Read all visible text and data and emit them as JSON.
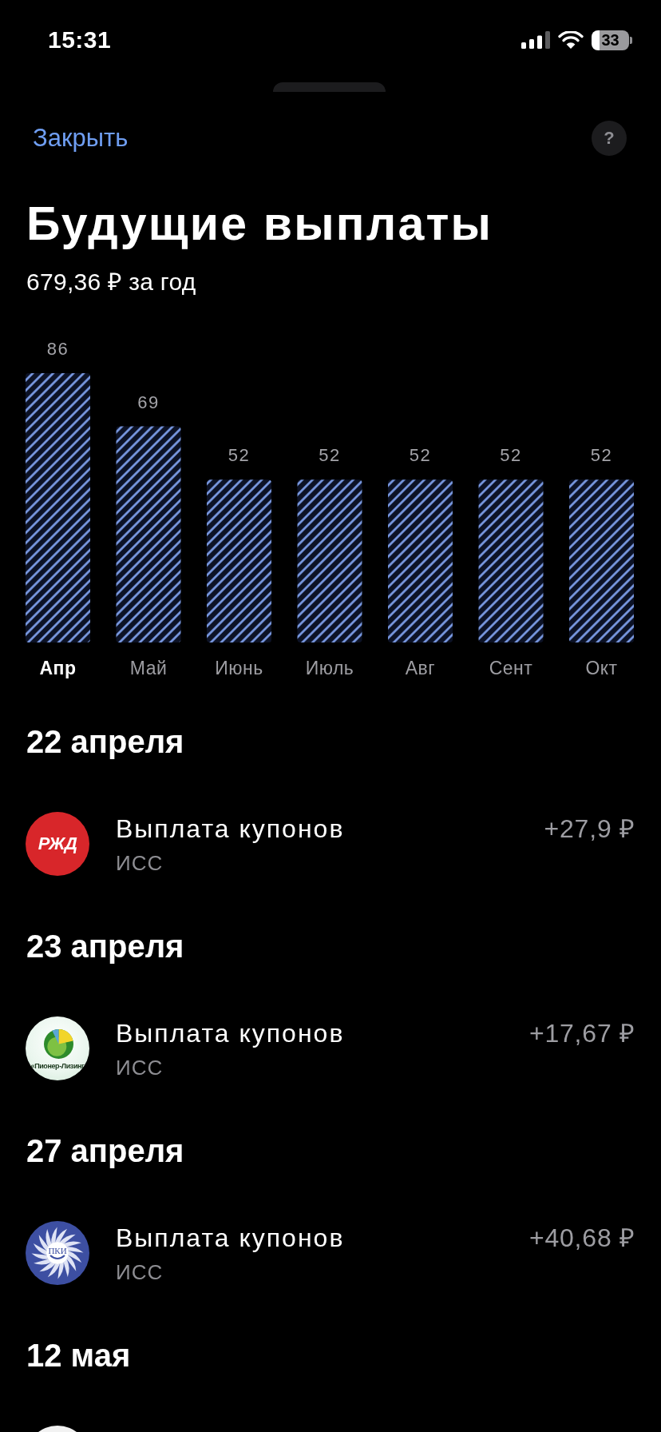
{
  "status_bar": {
    "time": "15:31",
    "battery": "33"
  },
  "header": {
    "close_link": "Закрыть",
    "help_button": "?"
  },
  "title": "Будущие выплаты",
  "total": "679,36 ₽ за год",
  "chart": {
    "chart_data": {
      "type": "bar",
      "categories": [
        "Апр",
        "Май",
        "Июнь",
        "Июль",
        "Авг",
        "Сент",
        "Окт"
      ],
      "values": [
        86,
        69,
        52,
        52,
        52,
        52,
        52
      ],
      "data_labels": true
    },
    "months": [
      {
        "selected": true
      },
      {
        "selected": false
      },
      {
        "selected": false
      },
      {
        "selected": false
      },
      {
        "selected": false
      },
      {
        "selected": false
      },
      {
        "selected": false
      }
    ]
  },
  "payments": [
    {
      "date": "22 апреля",
      "items": [
        {
          "kind": "payment",
          "logo_text": "РЖД",
          "title": "Выплата купонов",
          "subtitle": "ИСС",
          "amount": "+27,9 ₽"
        }
      ]
    },
    {
      "date": "23 апреля",
      "items": [
        {
          "kind": "payment",
          "logo_text": "«Пионер-Лизинг",
          "title": "Выплата купонов",
          "subtitle": "ИСС",
          "amount": "+17,67 ₽"
        }
      ]
    },
    {
      "date": "27 апреля",
      "items": [
        {
          "kind": "payment",
          "logo_text": "ПКИ",
          "title": "Выплата купонов",
          "subtitle": "ИСС",
          "amount": "+40,68 ₽"
        }
      ]
    },
    {
      "date": "12 мая",
      "items": [
        {
          "kind": "cut_off"
        }
      ]
    }
  ]
}
